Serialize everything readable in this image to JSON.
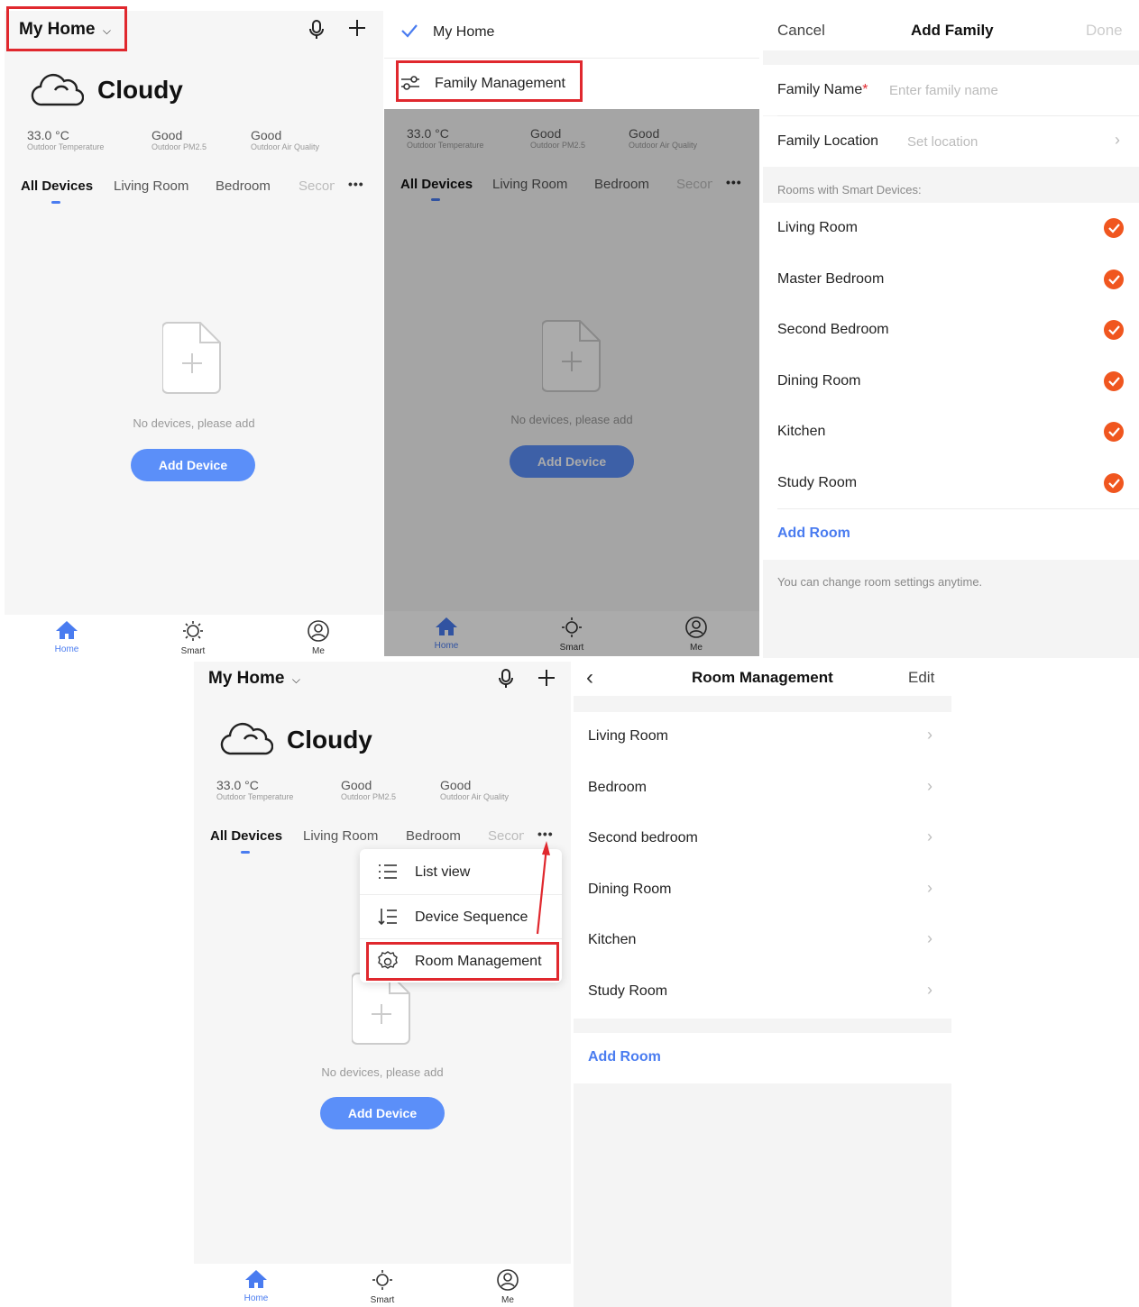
{
  "home": {
    "title": "My Home",
    "weather": "Cloudy",
    "stats": [
      {
        "value": "33.0 °C",
        "label": "Outdoor Temperature"
      },
      {
        "value": "Good",
        "label": "Outdoor PM2.5"
      },
      {
        "value": "Good",
        "label": "Outdoor Air Quality"
      }
    ],
    "tabs": [
      "All Devices",
      "Living Room",
      "Bedroom",
      "Secon"
    ],
    "more_label": "•••",
    "empty_text": "No devices, please add",
    "add_device": "Add Device",
    "nav": [
      "Home",
      "Smart",
      "Me"
    ]
  },
  "family_menu": {
    "current_home": "My Home",
    "manage": "Family Management"
  },
  "add_family": {
    "cancel": "Cancel",
    "title": "Add Family",
    "done": "Done",
    "name_label": "Family Name",
    "name_required": "*",
    "name_placeholder": "Enter family name",
    "location_label": "Family Location",
    "location_placeholder": "Set location",
    "rooms_header": "Rooms with Smart Devices:",
    "rooms": [
      "Living Room",
      "Master Bedroom",
      "Second Bedroom",
      "Dining Room",
      "Kitchen",
      "Study Room"
    ],
    "add_room": "Add Room",
    "hint": "You can change room settings anytime."
  },
  "more_menu": {
    "items": [
      "List view",
      "Device Sequence",
      "Room Management"
    ]
  },
  "room_mgmt": {
    "title": "Room Management",
    "edit": "Edit",
    "rooms": [
      "Living Room",
      "Bedroom",
      "Second bedroom",
      "Dining Room",
      "Kitchen",
      "Study Room"
    ],
    "add_room": "Add Room"
  },
  "colors": {
    "accent": "#5b8ff9",
    "highlight": "#e0282e",
    "check": "#f0561f"
  }
}
